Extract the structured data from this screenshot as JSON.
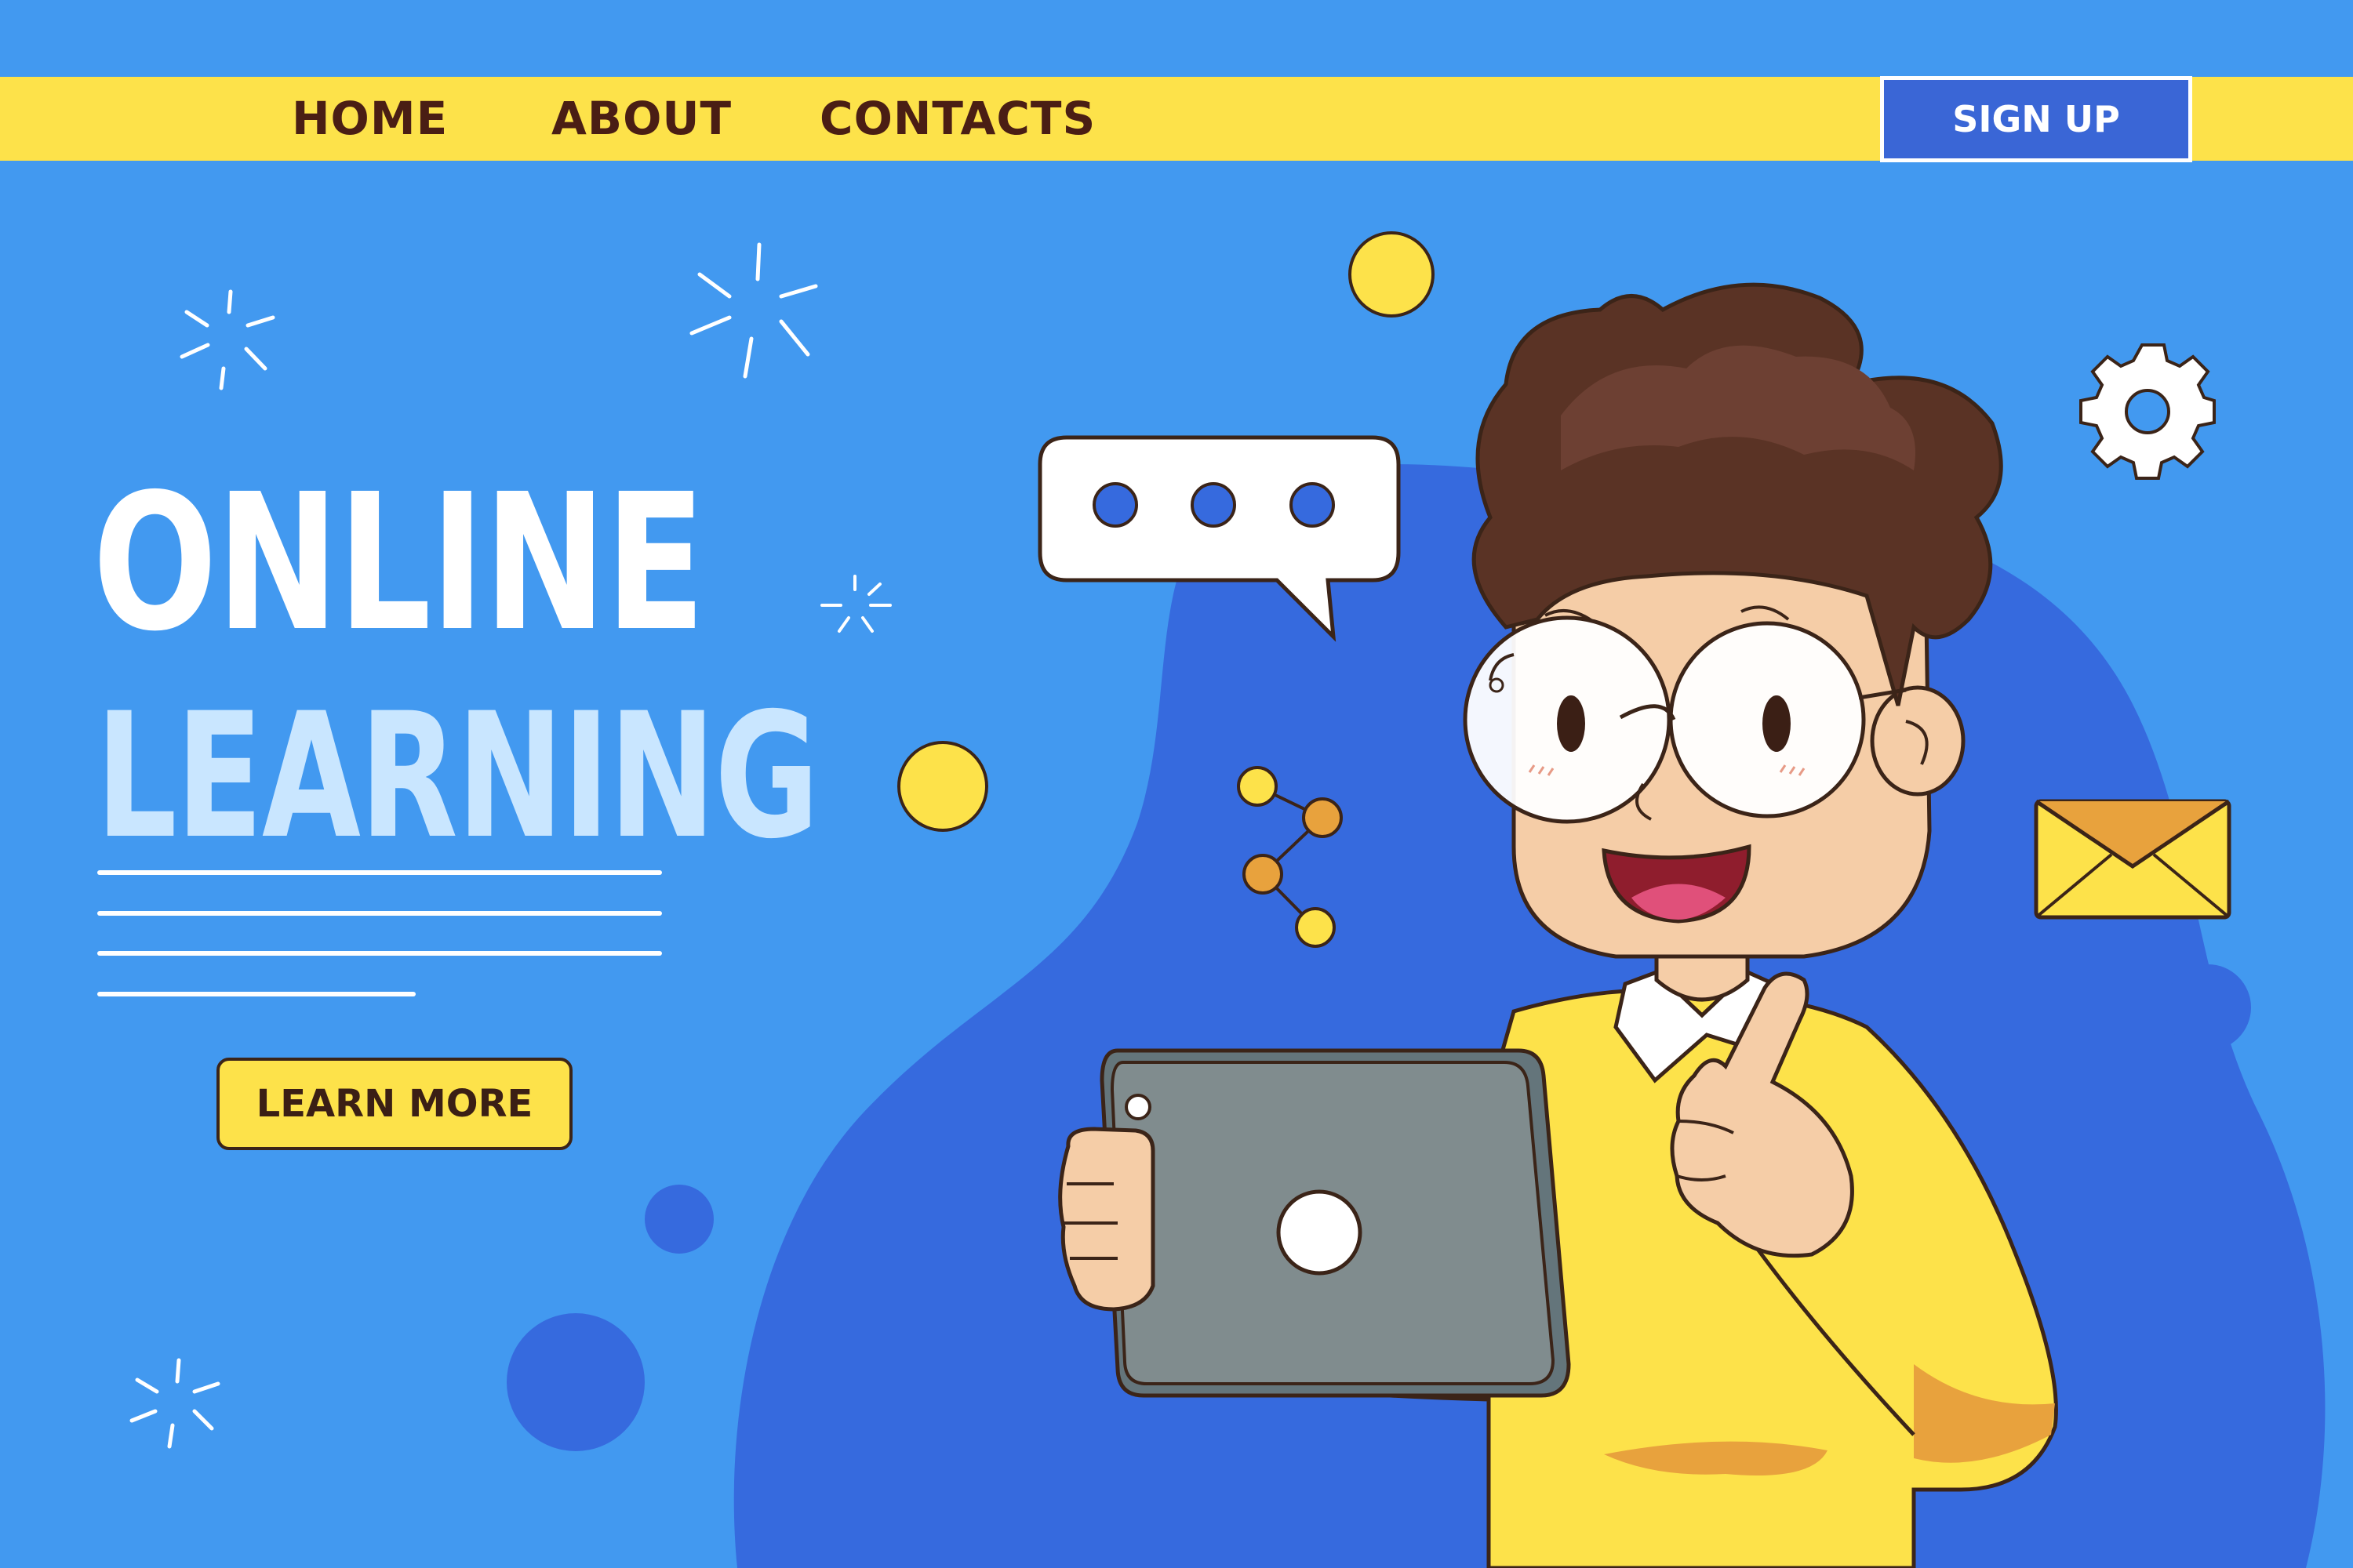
{
  "nav": {
    "home": "HOME",
    "about": "ABOUT",
    "contacts": "CONTACTS",
    "signup": "SIGN UP"
  },
  "hero": {
    "title": "ONLINE",
    "subtitle": "LEARNING",
    "cta": "LEARN MORE"
  },
  "colors": {
    "background": "#4299f0",
    "nav_bar": "#fde24a",
    "signup_button": "#3a66d6",
    "accent_blob": "#366ade",
    "sweater": "#fde24a",
    "hair": "#5a3325"
  },
  "icons": [
    "sparkle-icon",
    "chat-bubble-icon",
    "share-icon",
    "gear-icon",
    "envelope-icon",
    "tablet-device"
  ]
}
